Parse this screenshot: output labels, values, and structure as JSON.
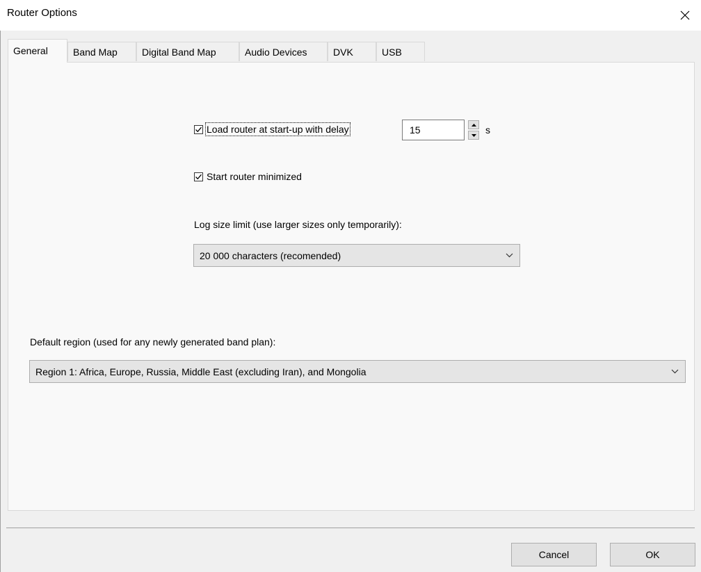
{
  "window": {
    "title": "Router Options",
    "close_icon": "close-icon"
  },
  "tabs": [
    {
      "label": "General",
      "active": true
    },
    {
      "label": "Band Map",
      "active": false
    },
    {
      "label": "Digital Band Map",
      "active": false
    },
    {
      "label": "Audio Devices",
      "active": false
    },
    {
      "label": "DVK",
      "active": false
    },
    {
      "label": "USB",
      "active": false
    }
  ],
  "general": {
    "load_router": {
      "label": "Load router at start-up with delay",
      "checked": true
    },
    "delay": {
      "value": "15",
      "unit": "s"
    },
    "start_minimized": {
      "label": "Start router minimized",
      "checked": true
    },
    "log_size": {
      "label": "Log size limit (use larger sizes only temporarily):",
      "selected": "20 000 characters (recomended)"
    },
    "default_region": {
      "label": "Default region (used for any newly generated band plan):",
      "selected": "Region 1: Africa, Europe, Russia, Middle East (excluding Iran), and Mongolia"
    }
  },
  "footer": {
    "cancel_label": "Cancel",
    "ok_label": "OK"
  }
}
